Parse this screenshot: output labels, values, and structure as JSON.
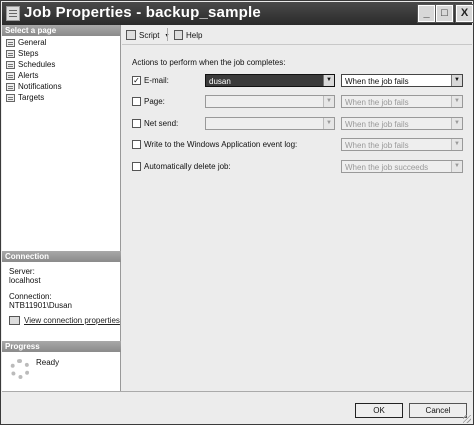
{
  "window": {
    "title": "Job Properties - backup_sample"
  },
  "titlebar_buttons": {
    "minimize": "_",
    "maximize": "□",
    "close": "X"
  },
  "sidebar": {
    "header": "Select a page",
    "items": [
      {
        "label": "General",
        "icon": "page-icon"
      },
      {
        "label": "Steps",
        "icon": "page-icon"
      },
      {
        "label": "Schedules",
        "icon": "page-icon"
      },
      {
        "label": "Alerts",
        "icon": "page-icon"
      },
      {
        "label": "Notifications",
        "icon": "page-icon",
        "selected": true
      },
      {
        "label": "Targets",
        "icon": "page-icon"
      }
    ]
  },
  "connection": {
    "header": "Connection",
    "server_label": "Server:",
    "server_value": "localhost",
    "connection_label": "Connection:",
    "connection_value": "NTB11901\\Dusan",
    "link_label": "View connection properties"
  },
  "progress": {
    "header": "Progress",
    "status": "Ready"
  },
  "toolbar": {
    "script_label": "Script",
    "script_caret": "▾",
    "help_label": "Help"
  },
  "main": {
    "actions_label": "Actions to perform when the job completes:",
    "rows": [
      {
        "label": "E-mail:",
        "checked": true,
        "check_mark": "✓",
        "operator": "dusan",
        "condition": "When the job fails",
        "enabled": true
      },
      {
        "label": "Page:",
        "checked": false,
        "check_mark": "",
        "operator": "",
        "condition": "When the job fails",
        "enabled": false
      },
      {
        "label": "Net send:",
        "checked": false,
        "check_mark": "",
        "operator": "",
        "condition": "When the job fails",
        "enabled": false
      },
      {
        "label": "Write to the Windows Application event log:",
        "checked": false,
        "check_mark": "",
        "condition": "When the job fails",
        "enabled": false
      },
      {
        "label": "Automatically delete job:",
        "checked": false,
        "check_mark": "",
        "condition": "When the job succeeds",
        "enabled": false
      }
    ],
    "combo_arrow": "▼"
  },
  "footer": {
    "ok_label": "OK",
    "cancel_label": "Cancel"
  }
}
